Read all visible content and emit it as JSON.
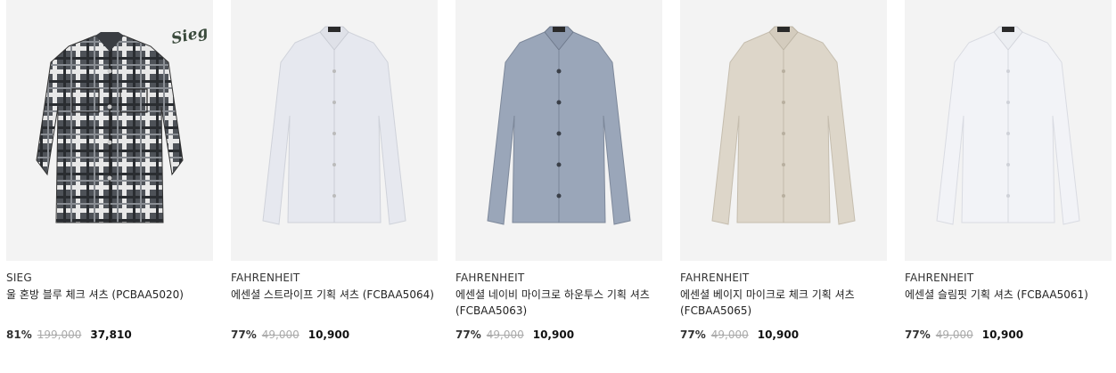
{
  "products": [
    {
      "brand": "SIEG",
      "name": "울 혼방 블루 체크 셔츠 (PCBAA5020)",
      "discount": "81%",
      "original_price": "199,000",
      "sale_price": "37,810",
      "logo_text": "Sieg",
      "shirt_color": "#5a5f66",
      "image": "plaid-shirt-icon"
    },
    {
      "brand": "FAHRENHEIT",
      "name": "에센셜 스트라이프 기획 셔츠 (FCBAA5064)",
      "discount": "77%",
      "original_price": "49,000",
      "sale_price": "10,900",
      "shirt_color": "#e6e8ef",
      "image": "stripe-dress-shirt-icon"
    },
    {
      "brand": "FAHRENHEIT",
      "name": "에센셜 네이비 마이크로 하운투스 기획 셔츠 (FCBAA5063)",
      "discount": "77%",
      "original_price": "49,000",
      "sale_price": "10,900",
      "shirt_color": "#9aa6b9",
      "image": "navy-dress-shirt-icon"
    },
    {
      "brand": "FAHRENHEIT",
      "name": "에센셜 베이지 마이크로 체크 기획 셔츠 (FCBAA5065)",
      "discount": "77%",
      "original_price": "49,000",
      "sale_price": "10,900",
      "shirt_color": "#ddd6c9",
      "image": "beige-dress-shirt-icon"
    },
    {
      "brand": "FAHRENHEIT",
      "name": "에센셜 슬림핏 기획 셔츠 (FCBAA5061)",
      "discount": "77%",
      "original_price": "49,000",
      "sale_price": "10,900",
      "shirt_color": "#f2f3f7",
      "image": "white-dress-shirt-icon"
    }
  ]
}
